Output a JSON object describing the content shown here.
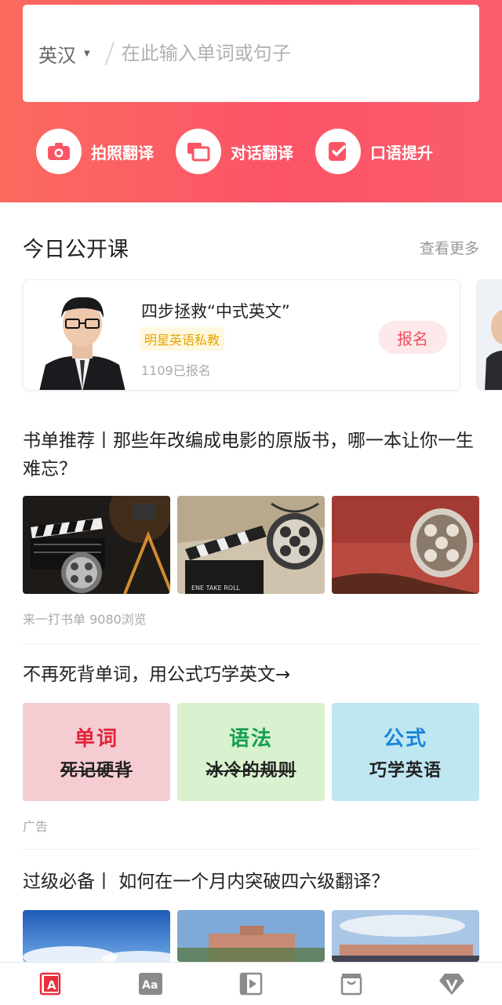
{
  "header": {
    "language": "英汉",
    "search_placeholder": "在此输入单词或句子",
    "actions": [
      {
        "label": "拍照翻译",
        "icon": "camera-icon"
      },
      {
        "label": "对话翻译",
        "icon": "dialogue-icon"
      },
      {
        "label": "口语提升",
        "icon": "speaking-check-icon"
      }
    ]
  },
  "open_class": {
    "title": "今日公开课",
    "more": "查看更多",
    "course": {
      "title": "四步拯救“中式英文”",
      "tag": "明星英语私教",
      "count": "1109已报名",
      "button": "报名"
    }
  },
  "feed": [
    {
      "title": "书单推荐丨那些年改编成电影的原版书，哪一本让你一生难忘？",
      "meta": "来一打书单   9080浏览"
    },
    {
      "title": "不再死背单词，用公式巧学英文→",
      "meta": "广告",
      "cards": [
        {
          "top": "单词",
          "bottom": "死记硬背",
          "color": "#e2233a"
        },
        {
          "top": "语法",
          "bottom": "冰冷的规则",
          "color": "#14a050"
        },
        {
          "top": "公式",
          "bottom": "巧学英语",
          "color": "#1d84d8"
        }
      ]
    },
    {
      "title": "过级必备丨 如何在一个月内突破四六级翻译？"
    }
  ],
  "nav": [
    {
      "icon": "dictionary-icon",
      "active": true
    },
    {
      "icon": "word-book-icon"
    },
    {
      "icon": "video-course-icon"
    },
    {
      "icon": "shop-bag-icon"
    },
    {
      "icon": "vip-icon"
    }
  ],
  "colors": {
    "brand": "#fb5468",
    "accent_red": "#e8303a"
  }
}
